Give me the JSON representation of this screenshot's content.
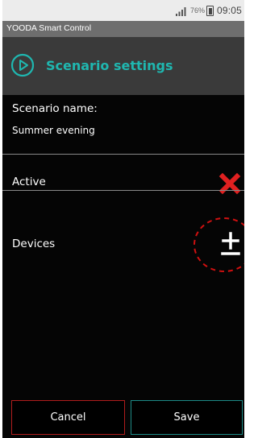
{
  "status_bar": {
    "battery_percent": "76%",
    "time": "09:05",
    "icons": [
      "signal-icon",
      "battery-icon"
    ]
  },
  "app_bar": {
    "title": "YOODA Smart Control"
  },
  "header": {
    "icon": "play-circle-icon",
    "title": "Scenario settings",
    "accent_color": "#1fb7b0"
  },
  "scenario": {
    "name_label": "Scenario name:",
    "name_value": "Summer evening"
  },
  "active": {
    "label": "Active",
    "icon": "close-x-icon",
    "state": "inactive",
    "icon_color": "#e02020"
  },
  "devices": {
    "label": "Devices",
    "icon": "plus-minus-icon",
    "highlight_color": "#d01010"
  },
  "buttons": {
    "cancel_label": "Cancel",
    "save_label": "Save",
    "cancel_border_color": "#b01c1c",
    "save_border_color": "#1d8a86"
  }
}
